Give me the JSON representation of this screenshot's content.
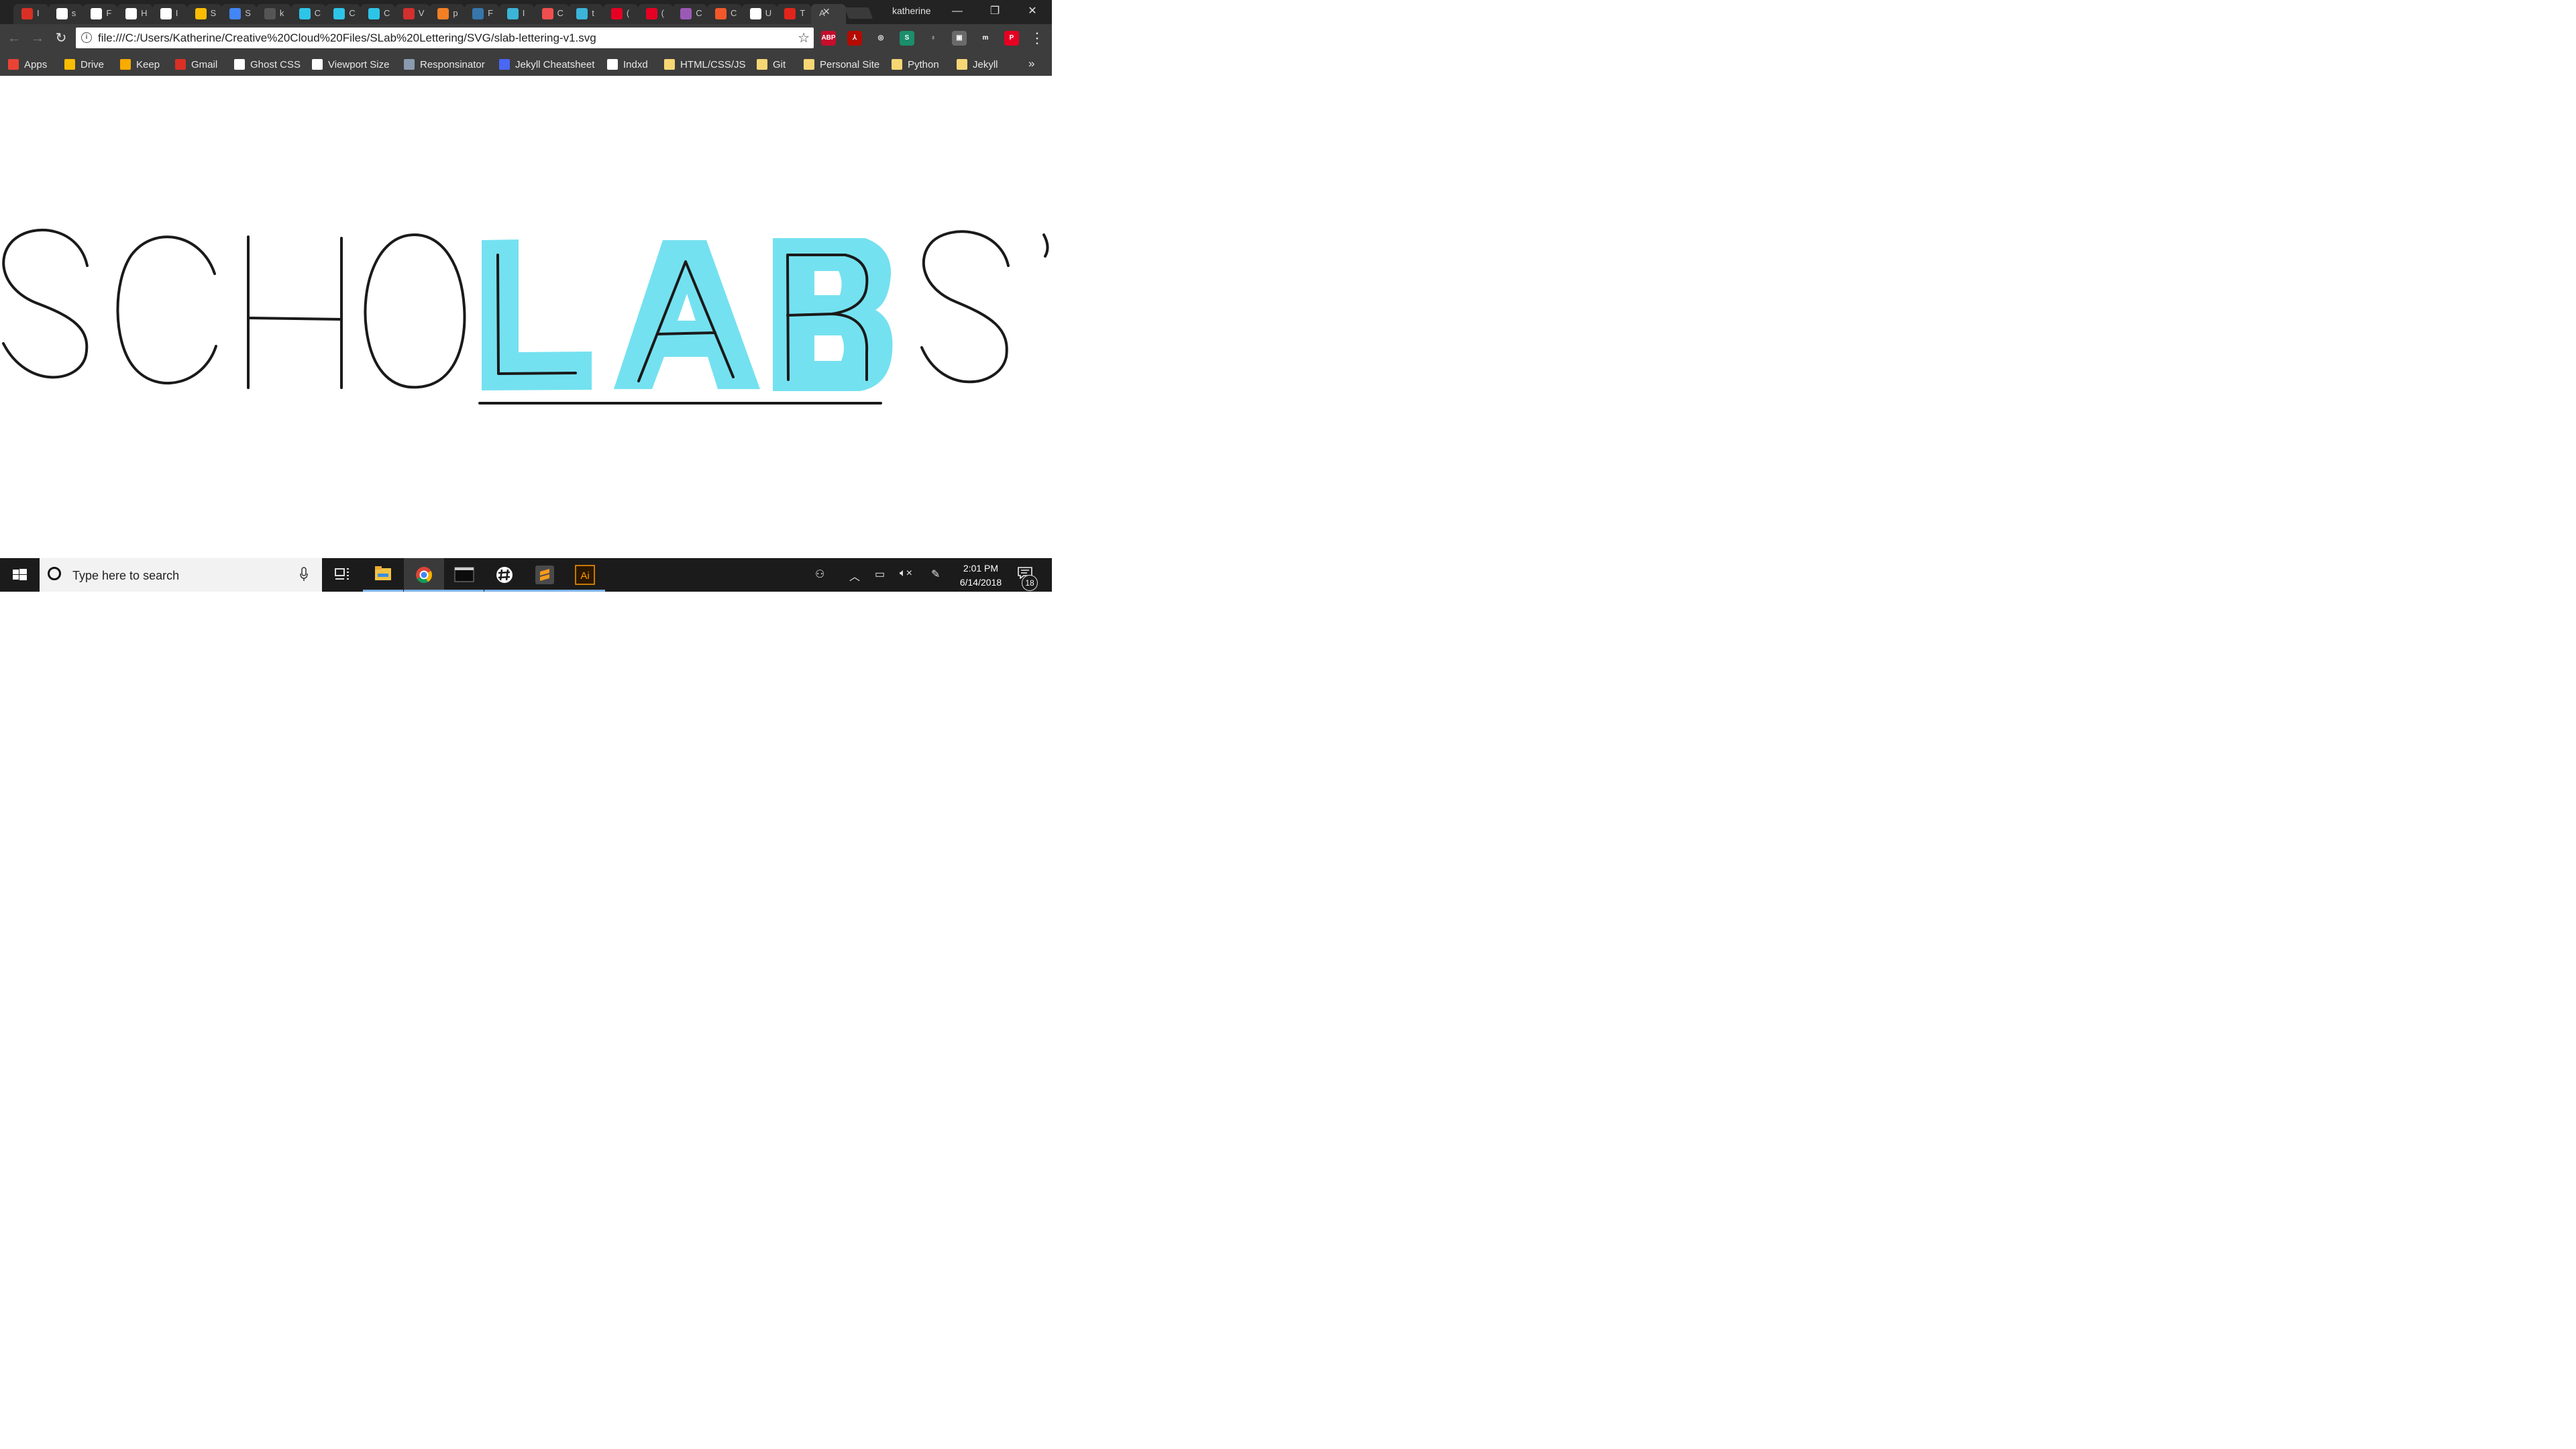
{
  "browser": {
    "tabs": [
      {
        "title": "I",
        "icon": "gmail-icon",
        "color": "#d93025"
      },
      {
        "title": "s",
        "icon": "github-icon",
        "color": "#ffffff"
      },
      {
        "title": "F",
        "icon": "github-icon",
        "color": "#ffffff"
      },
      {
        "title": "H",
        "icon": "document-icon",
        "color": "#ffffff"
      },
      {
        "title": "I",
        "icon": "github-icon",
        "color": "#ffffff"
      },
      {
        "title": "S",
        "icon": "drive-icon",
        "color": "#fbbc04"
      },
      {
        "title": "S",
        "icon": "docs-icon",
        "color": "#4285f4"
      },
      {
        "title": "k",
        "icon": "wiki-icon",
        "color": "#555555"
      },
      {
        "title": "C",
        "icon": "codepen-icon",
        "color": "#2ec4e8"
      },
      {
        "title": "C",
        "icon": "codepen-icon",
        "color": "#2ec4e8"
      },
      {
        "title": "C",
        "icon": "codepen-icon",
        "color": "#2ec4e8"
      },
      {
        "title": "V",
        "icon": "wattpad-icon",
        "color": "#d32f2f"
      },
      {
        "title": "p",
        "icon": "stackoverflow-icon",
        "color": "#f48024"
      },
      {
        "title": "F",
        "icon": "python-icon",
        "color": "#3776ab"
      },
      {
        "title": "I",
        "icon": "bird-icon",
        "color": "#3bb4d8"
      },
      {
        "title": "C",
        "icon": "flipboard-icon",
        "color": "#f04e4e"
      },
      {
        "title": "t",
        "icon": "bird-icon",
        "color": "#3bb4d8"
      },
      {
        "title": "(",
        "icon": "pinterest-icon",
        "color": "#e60023"
      },
      {
        "title": "(",
        "icon": "pinterest-icon",
        "color": "#e60023"
      },
      {
        "title": "C",
        "icon": "color-icon",
        "color": "#9b59b6"
      },
      {
        "title": "C",
        "icon": "grammarly-icon",
        "color": "#f2582c"
      },
      {
        "title": "U",
        "icon": "document-icon",
        "color": "#ffffff"
      },
      {
        "title": "T",
        "icon": "adobe-icon",
        "color": "#e1251b"
      },
      {
        "title": "A",
        "icon": "",
        "color": "#3d3d3d"
      }
    ],
    "profile_name": "katherine",
    "address": "file:///C:/Users/Katherine/Creative%20Cloud%20Files/SLab%20Lettering/SVG/slab-lettering-v1.svg",
    "extensions": [
      {
        "name": "adblock-icon",
        "label": "ABP",
        "color": "#c70d2c"
      },
      {
        "name": "acrobat-icon",
        "label": "⅄",
        "color": "#b30b00"
      },
      {
        "name": "inspect-icon",
        "label": "◎",
        "color": "#3d3d3d"
      },
      {
        "name": "s-extension-icon",
        "label": "S",
        "color": "#1b8f6b"
      },
      {
        "name": "bulb-icon",
        "label": "♁",
        "color": "#3d3d3d"
      },
      {
        "name": "square-extension-icon",
        "label": "▣",
        "color": "#6a6a6a"
      },
      {
        "name": "m-extension-icon",
        "label": "m",
        "color": "#3d3d3d"
      },
      {
        "name": "pinterest-icon",
        "label": "P",
        "color": "#e60023"
      }
    ],
    "bookmarks": [
      {
        "label": "Apps",
        "icon": "apps-grid-icon",
        "color": "#ea4335"
      },
      {
        "label": "Drive",
        "icon": "drive-icon",
        "color": "#fbbc04"
      },
      {
        "label": "Keep",
        "icon": "keep-icon",
        "color": "#f9ab00"
      },
      {
        "label": "Gmail",
        "icon": "gmail-icon",
        "color": "#d93025"
      },
      {
        "label": "Ghost CSS",
        "icon": "document-icon",
        "color": "#ffffff"
      },
      {
        "label": "Viewport Size",
        "icon": "viewport-icon",
        "color": "#ffffff"
      },
      {
        "label": "Responsinator",
        "icon": "responsinator-icon",
        "color": "#8a9bb0"
      },
      {
        "label": "Jekyll Cheatsheet",
        "icon": "jekyll-icon",
        "color": "#4a67f5"
      },
      {
        "label": "Indxd",
        "icon": "document-icon",
        "color": "#ffffff"
      },
      {
        "label": "HTML/CSS/JS",
        "icon": "folder-icon",
        "color": "#f7d774"
      },
      {
        "label": "Git",
        "icon": "folder-icon",
        "color": "#f7d774"
      },
      {
        "label": "Personal Site",
        "icon": "folder-icon",
        "color": "#f7d774"
      },
      {
        "label": "Python",
        "icon": "folder-icon",
        "color": "#f7d774"
      },
      {
        "label": "Jekyll",
        "icon": "folder-icon",
        "color": "#f7d774"
      }
    ],
    "bookmarks_more": "»"
  },
  "artwork": {
    "highlight_color": "#74e1f0",
    "stroke_color": "#1a1a1a"
  },
  "taskbar": {
    "search_placeholder": "Type here to search",
    "time": "2:01 PM",
    "date": "6/14/2018",
    "notification_count": "18"
  }
}
